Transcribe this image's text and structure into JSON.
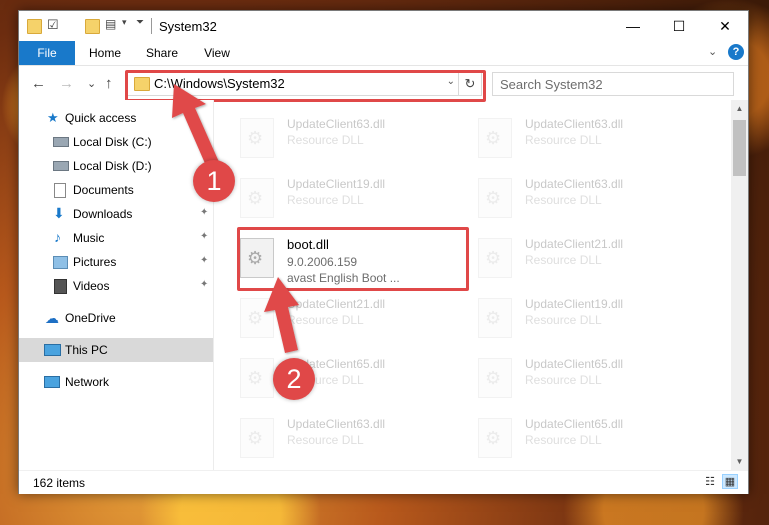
{
  "window": {
    "title": "System32",
    "controls": {
      "minimize": "—",
      "maximize": "☐",
      "close": "✕"
    }
  },
  "ribbon": {
    "tabs": [
      "File",
      "Home",
      "Share",
      "View"
    ],
    "expand_glyph": "⌄",
    "help_glyph": "?"
  },
  "nav": {
    "back": "←",
    "forward": "→",
    "recent": "⌄",
    "up": "↑",
    "address": "C:\\Windows\\System32",
    "address_dropdown": "⌄",
    "refresh": "↻",
    "search_placeholder": "Search System32"
  },
  "sidebar": {
    "items": [
      {
        "label": "Quick access",
        "icon": "star-icon"
      },
      {
        "label": "Local Disk (C:)",
        "icon": "drive-icon"
      },
      {
        "label": "Local Disk (D:)",
        "icon": "drive-icon"
      },
      {
        "label": "Documents",
        "icon": "document-icon"
      },
      {
        "label": "Downloads",
        "icon": "download-icon",
        "pinned": true
      },
      {
        "label": "Music",
        "icon": "music-icon",
        "pinned": true
      },
      {
        "label": "Pictures",
        "icon": "pictures-icon",
        "pinned": true
      },
      {
        "label": "Videos",
        "icon": "videos-icon",
        "pinned": true
      },
      {
        "label": "OneDrive",
        "icon": "cloud-icon"
      },
      {
        "label": "This PC",
        "icon": "computer-icon",
        "selected": true
      },
      {
        "label": "Network",
        "icon": "network-icon"
      }
    ],
    "pin_glyph": "📌"
  },
  "files": [
    {
      "name": "UpdateClient63.dll",
      "desc": "Resource DLL"
    },
    {
      "name": "UpdateClient63.dll",
      "desc": "Resource DLL"
    },
    {
      "name": "UpdateClient19.dll",
      "desc": "Resource DLL"
    },
    {
      "name": "UpdateClient63.dll",
      "desc": "Resource DLL"
    },
    {
      "name": "boot.dll",
      "version": "9.0.2006.159",
      "desc": "avast English Boot ..."
    },
    {
      "name": "UpdateClient21.dll",
      "desc": "Resource DLL"
    },
    {
      "name": "UpdateClient21.dll",
      "desc": "Resource DLL"
    },
    {
      "name": "UpdateClient19.dll",
      "desc": "Resource DLL"
    },
    {
      "name": "UpdateClient65.dll",
      "desc": "Resource DLL"
    },
    {
      "name": "UpdateClient65.dll",
      "desc": "Resource DLL"
    },
    {
      "name": "UpdateClient63.dll",
      "desc": "Resource DLL"
    },
    {
      "name": "UpdateClient65.dll",
      "desc": "Resource DLL"
    }
  ],
  "status": {
    "item_count": "162 items"
  },
  "annotations": {
    "step1": "1",
    "step2": "2",
    "color": "#e04848"
  }
}
